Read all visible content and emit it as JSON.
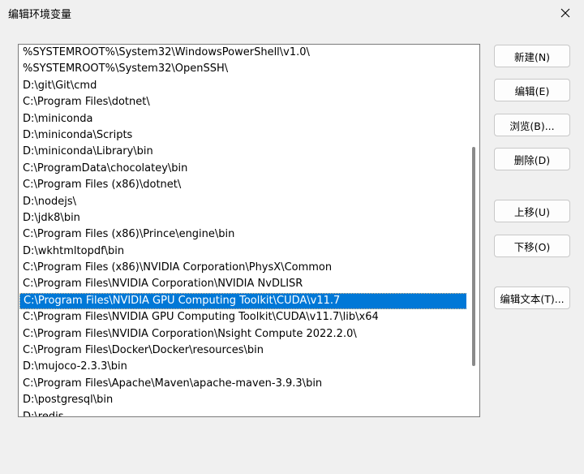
{
  "window": {
    "title": "编辑环境变量"
  },
  "path_list": {
    "items": [
      "%SYSTEMROOT%\\System32\\WindowsPowerShell\\v1.0\\",
      "%SYSTEMROOT%\\System32\\OpenSSH\\",
      "D:\\git\\Git\\cmd",
      "C:\\Program Files\\dotnet\\",
      "D:\\miniconda",
      "D:\\miniconda\\Scripts",
      "D:\\miniconda\\Library\\bin",
      "C:\\ProgramData\\chocolatey\\bin",
      "C:\\Program Files (x86)\\dotnet\\",
      "D:\\nodejs\\",
      "D:\\jdk8\\bin",
      "C:\\Program Files (x86)\\Prince\\engine\\bin",
      "D:\\wkhtmltopdf\\bin",
      "C:\\Program Files (x86)\\NVIDIA Corporation\\PhysX\\Common",
      "C:\\Program Files\\NVIDIA Corporation\\NVIDIA NvDLISR",
      "C:\\Program Files\\NVIDIA GPU Computing Toolkit\\CUDA\\v11.7",
      "C:\\Program Files\\NVIDIA GPU Computing Toolkit\\CUDA\\v11.7\\lib\\x64",
      "C:\\Program Files\\NVIDIA Corporation\\Nsight Compute 2022.2.0\\",
      "C:\\Program Files\\Docker\\Docker\\resources\\bin",
      "D:\\mujoco-2.3.3\\bin",
      "C:\\Program Files\\Apache\\Maven\\apache-maven-3.9.3\\bin",
      "D:\\postgresql\\bin",
      "D:\\redis"
    ],
    "selected_index": 15
  },
  "buttons": {
    "new": "新建(N)",
    "edit": "编辑(E)",
    "browse": "浏览(B)...",
    "delete": "删除(D)",
    "move_up": "上移(U)",
    "move_down": "下移(O)",
    "edit_text": "编辑文本(T)..."
  },
  "colors": {
    "selection": "#0078d7",
    "background": "#f0f0f0"
  }
}
